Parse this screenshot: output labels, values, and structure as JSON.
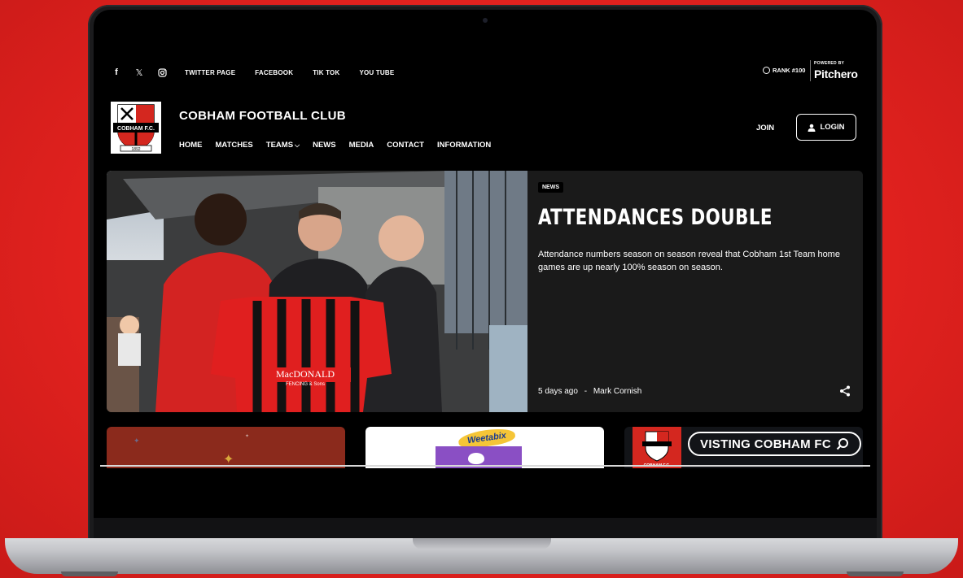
{
  "top_bar": {
    "social_icons": [
      {
        "name": "facebook-icon",
        "glyph": "f"
      },
      {
        "name": "x-icon",
        "glyph": "𝕏"
      },
      {
        "name": "instagram-icon",
        "glyph": "◎"
      }
    ],
    "links": [
      "TWITTER PAGE",
      "FACEBOOK",
      "TIK TOK",
      "YOU TUBE"
    ],
    "rank": "RANK #100",
    "powered_by": "POWERED BY",
    "brand": "Pitchero"
  },
  "header": {
    "club_name": "COBHAM FOOTBALL CLUB",
    "nav": [
      "HOME",
      "MATCHES",
      "TEAMS",
      "NEWS",
      "MEDIA",
      "CONTACT",
      "INFORMATION"
    ],
    "join_label": "JOIN",
    "login_label": "LOGIN"
  },
  "crest": {
    "text": "COBHAM F.C.",
    "year": "1892",
    "colors": [
      "#d4271f",
      "#000000",
      "#ffffff"
    ]
  },
  "hero": {
    "tag": "NEWS",
    "headline": "ATTENDANCES DOUBLE",
    "summary": "Attendance numbers season on season reveal that Cobham 1st Team home games are up nearly 100% season on season.",
    "time_ago": "5 days ago",
    "separator": "-",
    "author": "Mark Cornish",
    "shirt_sponsor": "MacDONALD",
    "shirt_sponsor_sub": "FENCING & Sons"
  },
  "cards": {
    "card2_brand": "Weetabix",
    "card3_button": "VISTING COBHAM FC",
    "card3_crest_text": "COBHAM F.C."
  },
  "colors": {
    "background_red": "#e3221f",
    "kit_red": "#e01f1f",
    "panel": "#1a1a1a"
  }
}
